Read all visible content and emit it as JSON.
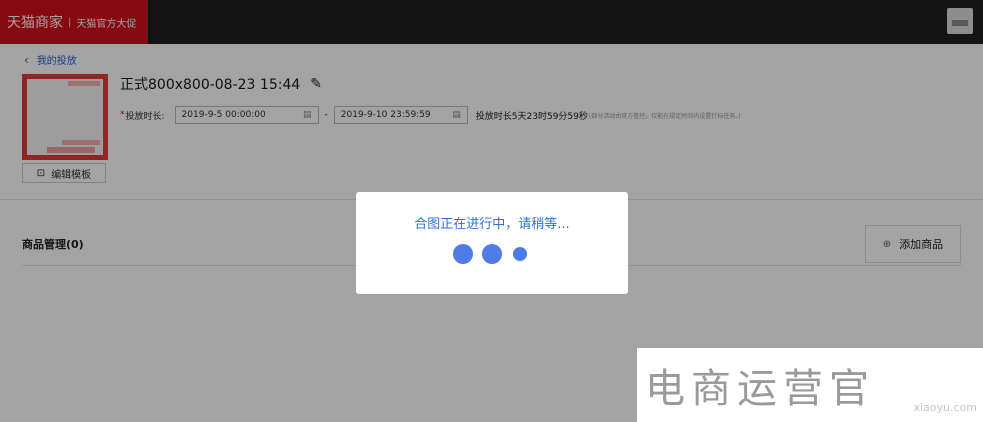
{
  "header": {
    "brand": "天猫商家",
    "separator": "|",
    "subtitle": "天猫官方大促"
  },
  "nav": {
    "back_label": "我的投放",
    "back_icon": "chevron-left-icon"
  },
  "template": {
    "edit_button": "编辑模板",
    "edit_icon": "edit-icon"
  },
  "campaign": {
    "title": "正式800x800-08-23 15:44",
    "title_edit_icon": "pencil-square-icon",
    "duration_label": "投放时长:",
    "required_mark": "*",
    "start_datetime": "2019-9-5 00:00:00",
    "end_datetime": "2019-9-10 23:59:59",
    "range_separator": "-",
    "duration_text": "投放时长5天23时59分59秒",
    "duration_note": "(部分活动由官方管控，仅能在规定时间内设置打标任务。)"
  },
  "products": {
    "section_label": "商品管理(0)",
    "add_button": "添加商品",
    "add_icon": "plus-circle-icon"
  },
  "modal": {
    "message": "合图正在进行中，请稍等...",
    "accent_color": "#4f7be8"
  },
  "watermark": {
    "text": "电商运营官",
    "sub": "xiaoyu.com"
  },
  "colors": {
    "brand_red": "#d3111b",
    "topbar": "#1f1f1f",
    "link_blue": "#2a5bd7"
  }
}
